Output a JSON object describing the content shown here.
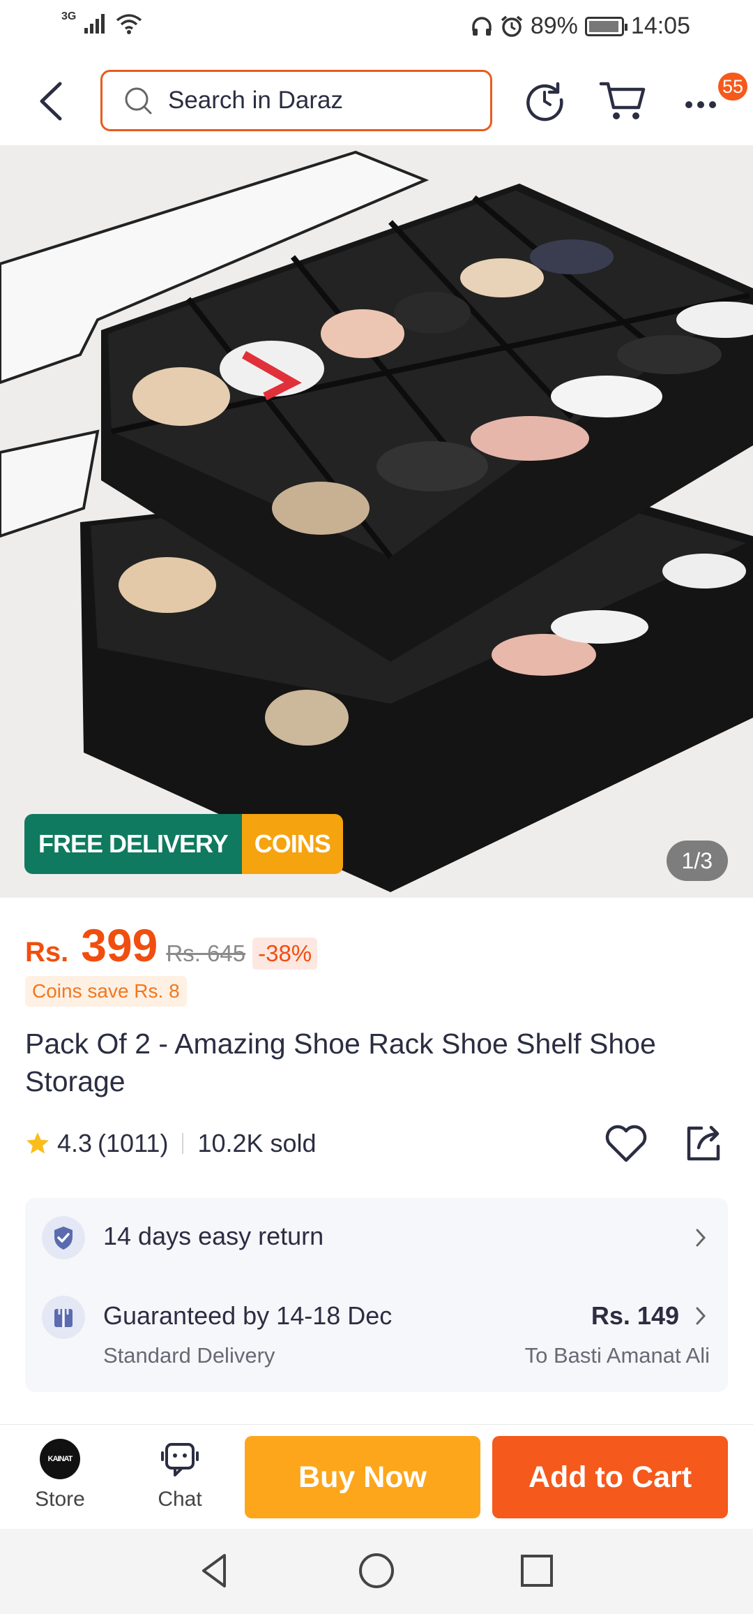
{
  "status_bar": {
    "network": "3G",
    "battery": "89%",
    "time": "14:05",
    "icons": [
      "signal-icon",
      "wifi-icon",
      "headphones-icon",
      "alarm-icon",
      "battery-icon"
    ]
  },
  "header": {
    "back_icon": "back-arrow-icon",
    "search_placeholder": "Search in Daraz",
    "history_icon": "history-icon",
    "cart_icon": "cart-icon",
    "more_icon": "more-icon",
    "notification_count": "55"
  },
  "gallery": {
    "promo_free_delivery": "FREE DELIVERY",
    "promo_coins": "COINS",
    "page_indicator": "1/3",
    "colors": {
      "free_delivery": "#0f7a5f",
      "coins": "#f5a30e"
    }
  },
  "product": {
    "currency": "Rs.",
    "price": "399",
    "original_price": "Rs. 645",
    "discount": "-38%",
    "coins_save": "Coins save Rs. 8",
    "title": "Pack Of 2 - Amazing Shoe Rack Shoe Shelf Shoe Storage",
    "rating": "4.3",
    "rating_count": "(1011)",
    "sold": "10.2K sold"
  },
  "services": {
    "return_text": "14 days easy return",
    "delivery_guarantee": "Guaranteed by 14-18 Dec",
    "delivery_type": "Standard Delivery",
    "delivery_fee": "Rs. 149",
    "delivery_destination": "To Basti Amanat Ali"
  },
  "bottom_bar": {
    "store_label": "Store",
    "store_logo_text": "KAINAT",
    "chat_label": "Chat",
    "buy_now": "Buy Now",
    "add_to_cart": "Add to Cart",
    "colors": {
      "buy_now": "#fda61c",
      "add_to_cart": "#f5591c",
      "accent": "#f04e0f"
    }
  },
  "nav_bar": {
    "icons": [
      "nav-back-icon",
      "nav-home-icon",
      "nav-recents-icon"
    ]
  }
}
